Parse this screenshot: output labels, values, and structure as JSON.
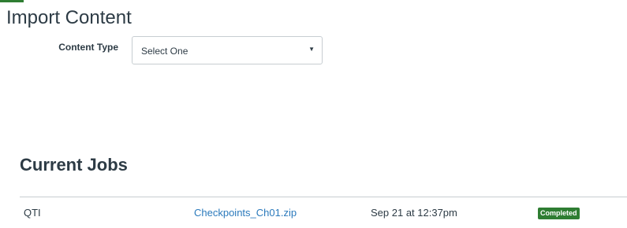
{
  "page": {
    "title": "Import Content"
  },
  "form": {
    "content_type_label": "Content Type",
    "content_type_select": {
      "selected": "Select One"
    },
    "arrow_icon": "caret-down"
  },
  "jobs": {
    "section_title": "Current Jobs",
    "rows": [
      {
        "type": "QTI",
        "file": "Checkpoints_Ch01.zip",
        "date": "Sep 21 at 12:37pm",
        "status": "Completed"
      }
    ]
  },
  "colors": {
    "accent": "#2e7d32",
    "link": "#2b7abc",
    "text": "#2d3b45",
    "border": "#c7cdd1",
    "status_completed": "#2e7d32"
  }
}
